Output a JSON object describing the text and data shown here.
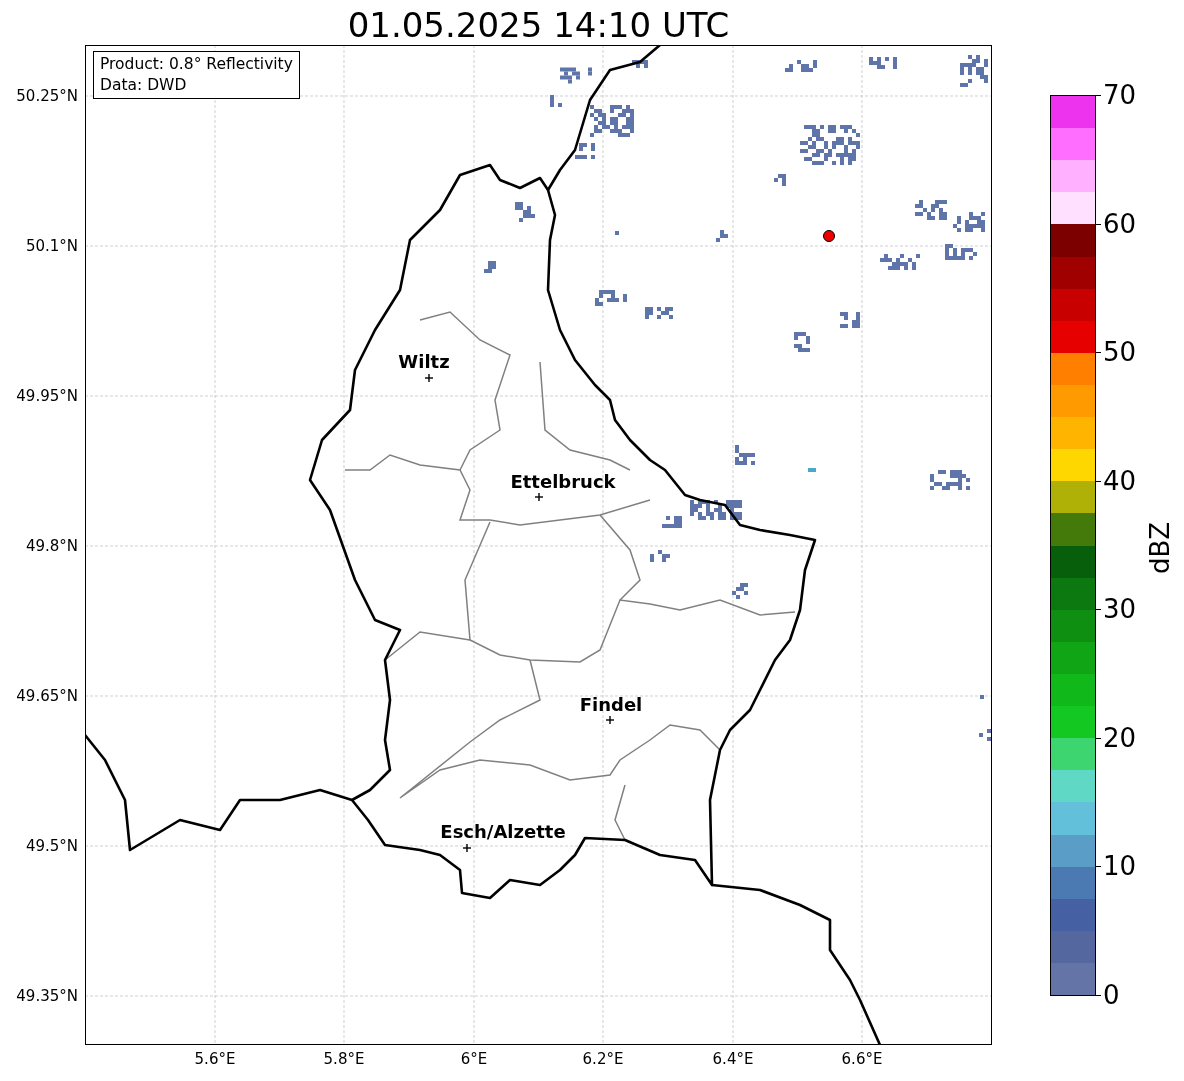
{
  "title": "01.05.2025 14:10 UTC",
  "info_box": [
    "Product: 0.8° Reflectivity",
    "Data: DWD"
  ],
  "lat_labels": [
    "50.25°N",
    "50.1°N",
    "49.95°N",
    "49.8°N",
    "49.65°N",
    "49.5°N",
    "49.35°N"
  ],
  "lon_labels": [
    "5.6°E",
    "5.8°E",
    "6°E",
    "6.2°E",
    "6.4°E",
    "6.6°E"
  ],
  "cities": [
    {
      "name": "Wiltz"
    },
    {
      "name": "Ettelbruck"
    },
    {
      "name": "Findel"
    },
    {
      "name": "Esch/Alzette"
    }
  ],
  "colorbar": {
    "label": "dBZ",
    "tick_labels": [
      "70",
      "60",
      "50",
      "40",
      "30",
      "20",
      "10",
      "0"
    ],
    "bands": [
      {
        "color": "#ee33ee"
      },
      {
        "color": "#ff6eff"
      },
      {
        "color": "#ffb0ff"
      },
      {
        "color": "#ffe0ff"
      },
      {
        "color": "#7c0000"
      },
      {
        "color": "#a00000"
      },
      {
        "color": "#c80000"
      },
      {
        "color": "#e60000"
      },
      {
        "color": "#ff7f00"
      },
      {
        "color": "#ff9a00"
      },
      {
        "color": "#ffb500"
      },
      {
        "color": "#ffd700"
      },
      {
        "color": "#b0b106"
      },
      {
        "color": "#437a0a"
      },
      {
        "color": "#075f0b"
      },
      {
        "color": "#0b7810"
      },
      {
        "color": "#0e8f12"
      },
      {
        "color": "#10a515"
      },
      {
        "color": "#11b81a"
      },
      {
        "color": "#13c821"
      },
      {
        "color": "#3dd56f"
      },
      {
        "color": "#5fd8c5"
      },
      {
        "color": "#62c0da"
      },
      {
        "color": "#5a9ec8"
      },
      {
        "color": "#4b7ab3"
      },
      {
        "color": "#4560a3"
      },
      {
        "color": "#54679e"
      },
      {
        "color": "#6574a6"
      }
    ]
  }
}
